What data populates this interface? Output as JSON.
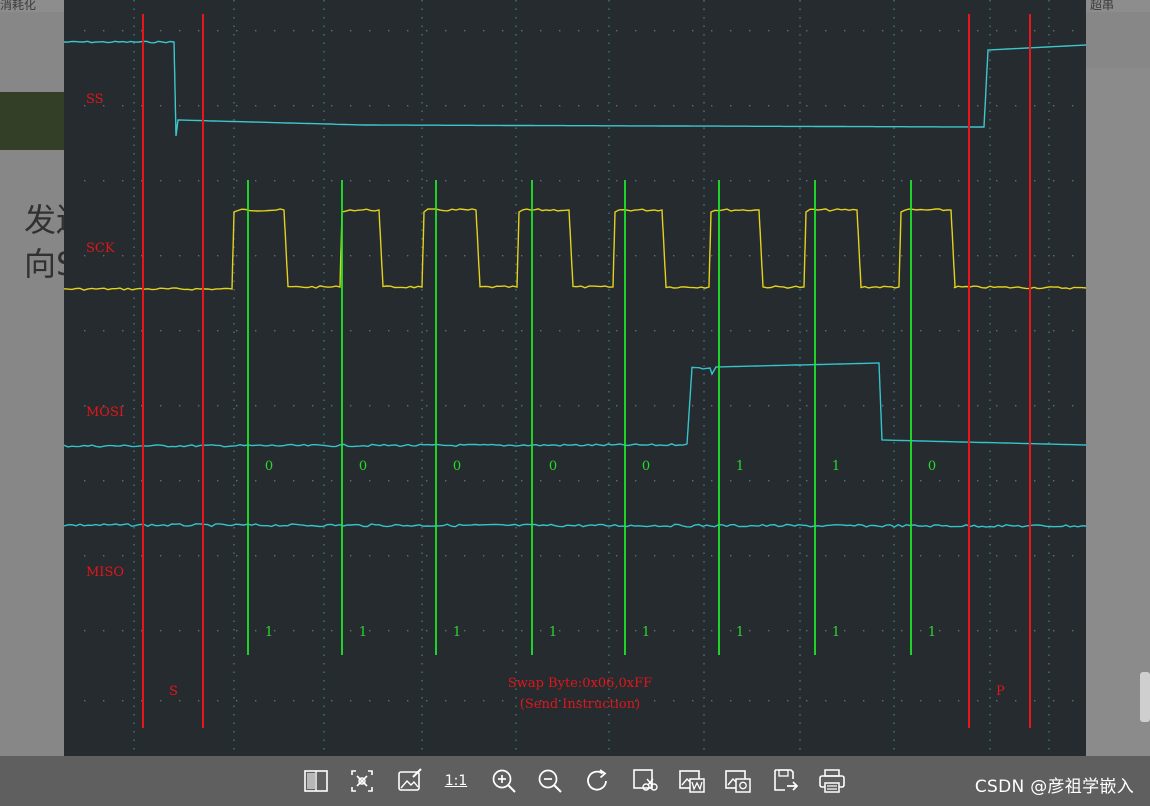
{
  "background_document": {
    "top_left_text": "消耗化",
    "top_right_text": "超串",
    "big_text_line1": "发送",
    "big_text_line2": "向S"
  },
  "scope": {
    "channels": [
      "SS",
      "SCK",
      "MOSI",
      "MISO"
    ],
    "mosi_bits": [
      "0",
      "0",
      "0",
      "0",
      "0",
      "1",
      "1",
      "0"
    ],
    "miso_bits": [
      "1",
      "1",
      "1",
      "1",
      "1",
      "1",
      "1",
      "1"
    ],
    "start_marker": "S",
    "stop_marker": "P",
    "annotation_line1": "Swap Byte:0x06,0xFF",
    "annotation_line2": "(Send Instruction)",
    "colors": {
      "background": "#252b2e",
      "label_red": "#e0161b",
      "cursor_red": "#e8151a",
      "cursor_green": "#1fe62a",
      "bit_green": "#2ad82f",
      "ss_trace": "#3ec6cf",
      "sck_trace": "#e3d11e",
      "mosi_trace": "#35c3cc",
      "miso_trace": "#35c3cc",
      "grid": "#3d8a8a"
    }
  },
  "toolbar": {
    "zoom_label": "1:1",
    "tools": [
      "fit-window-icon",
      "smart-select-icon",
      "edit-image-icon",
      "actual-size-icon",
      "zoom-in-icon",
      "zoom-out-icon",
      "rotate-icon",
      "crop-icon",
      "image-to-word-icon",
      "image-to-text-icon",
      "save-as-icon",
      "print-icon"
    ]
  },
  "watermark": "CSDN @彦祖学嵌入"
}
